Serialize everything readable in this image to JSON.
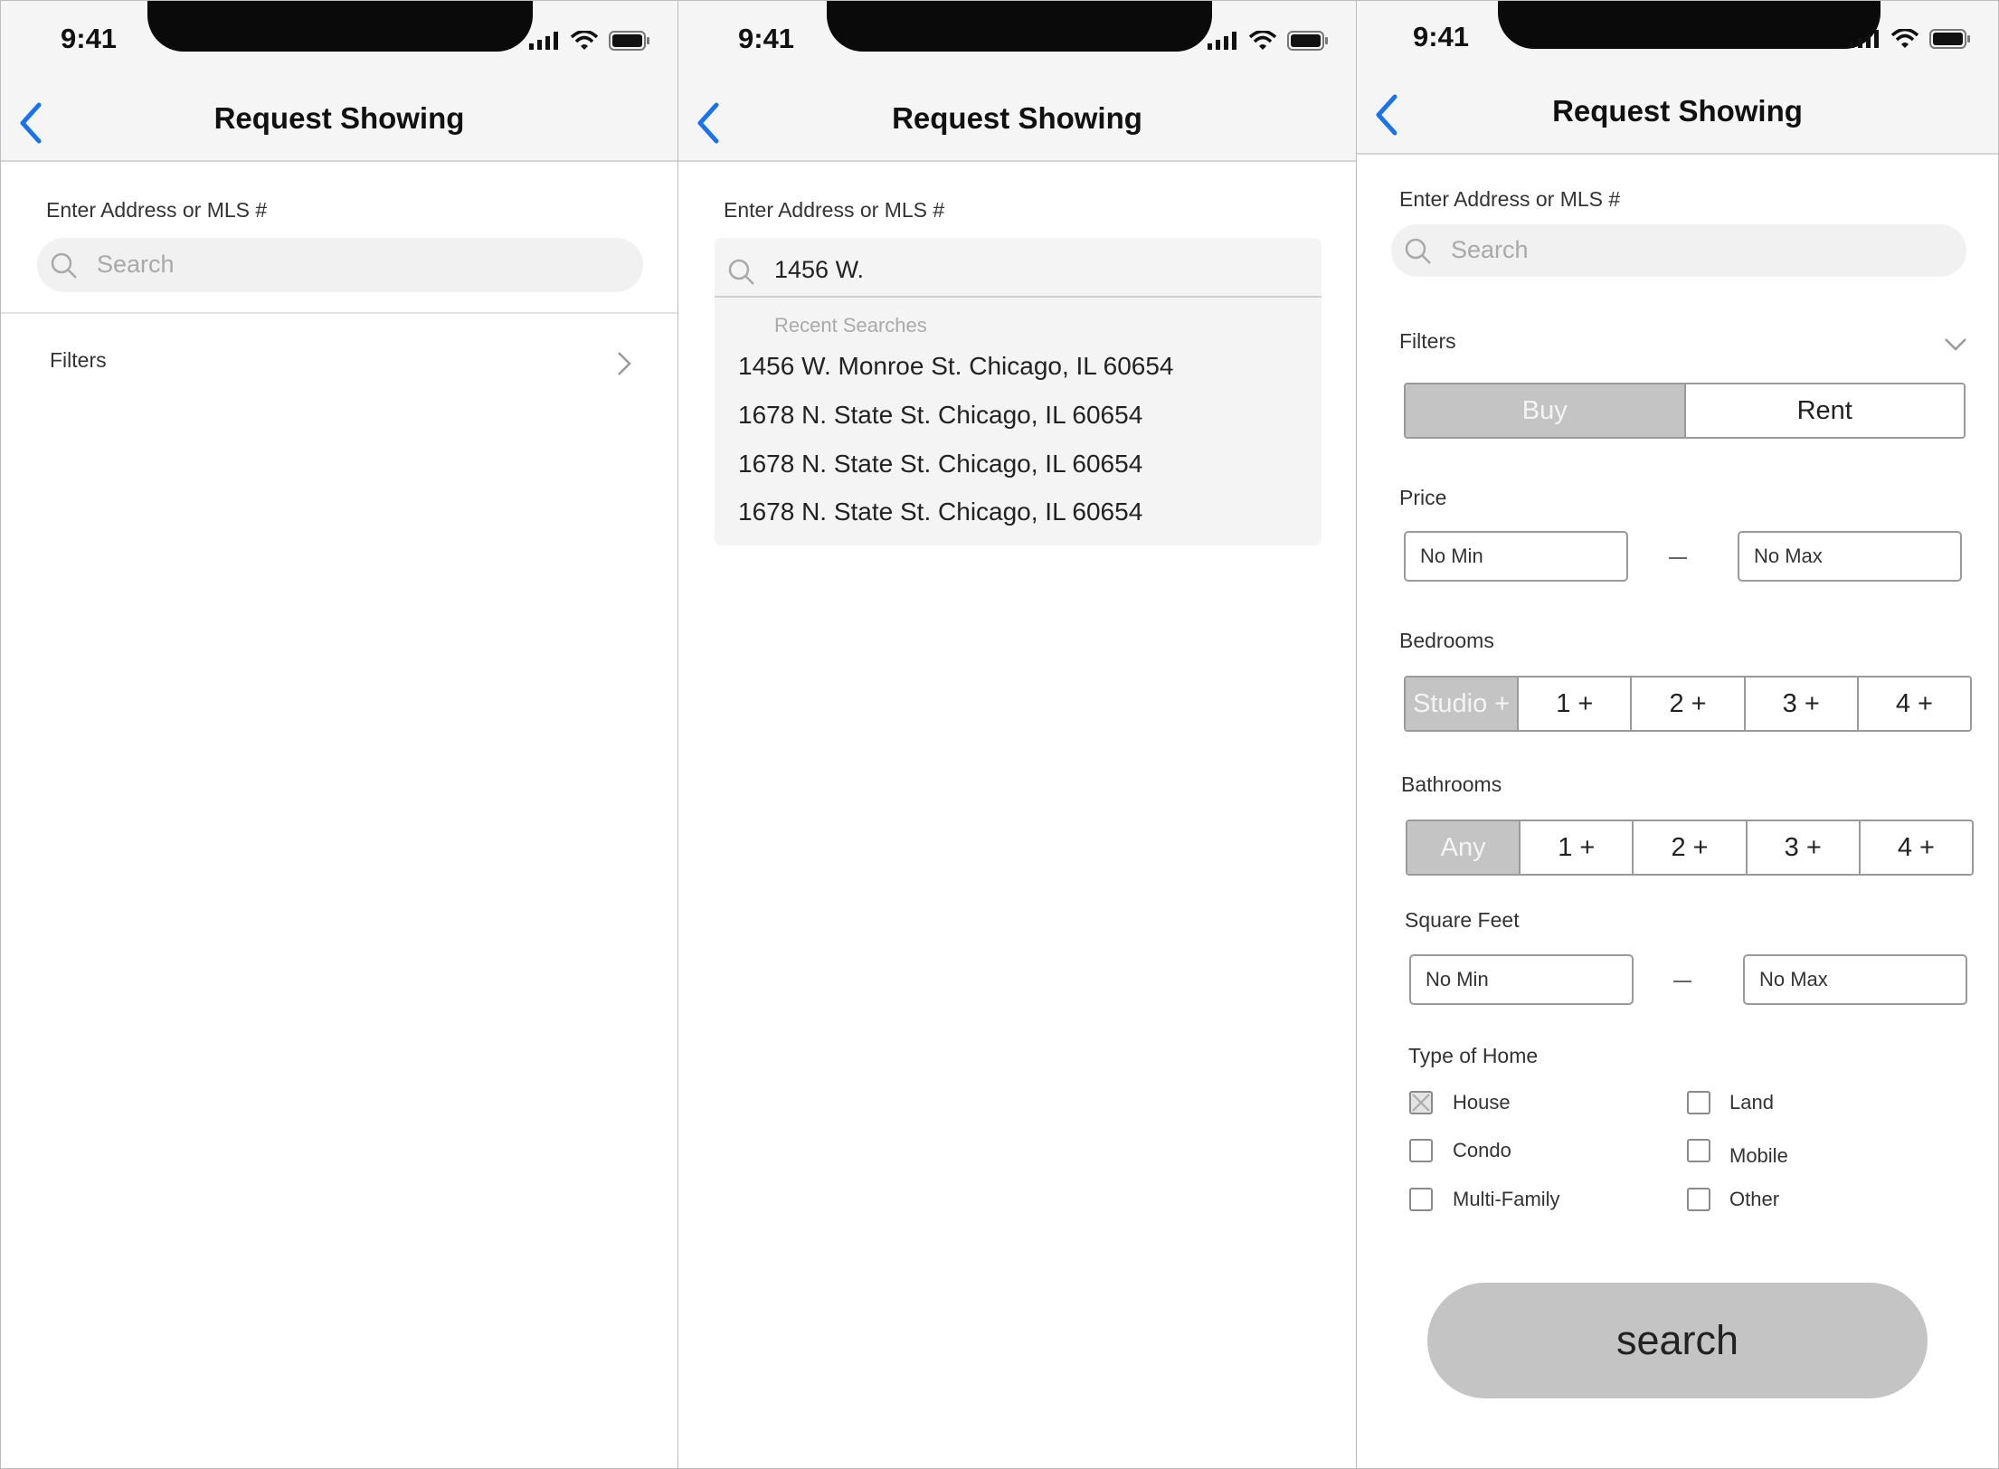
{
  "status": {
    "time": "9:41"
  },
  "header": {
    "title": "Request Showing"
  },
  "search": {
    "label": "Enter Address or MLS #",
    "placeholder": "Search"
  },
  "filters": {
    "label": "Filters"
  },
  "autocomplete": {
    "typed_value": "1456 W.",
    "recent_label": "Recent Searches",
    "items": [
      "1456 W. Monroe St. Chicago, IL 60654",
      "1678 N. State St. Chicago, IL 60654",
      "1678 N. State St. Chicago, IL 60654",
      "1678 N. State St. Chicago, IL 60654"
    ]
  },
  "listing_type": {
    "options": [
      "Buy",
      "Rent"
    ],
    "selected": "Buy"
  },
  "price": {
    "label": "Price",
    "min_placeholder": "No Min",
    "max_placeholder": "No Max"
  },
  "bedrooms": {
    "label": "Bedrooms",
    "options": [
      "Studio +",
      "1 +",
      "2 +",
      "3 +",
      "4 +"
    ],
    "selected": "Studio +"
  },
  "bathrooms": {
    "label": "Bathrooms",
    "options": [
      "Any",
      "1 +",
      "2 +",
      "3 +",
      "4 +"
    ],
    "selected": "Any"
  },
  "square_feet": {
    "label": "Square Feet",
    "min_placeholder": "No Min",
    "max_placeholder": "No Max"
  },
  "home_type": {
    "label": "Type of Home",
    "options": [
      {
        "label": "House",
        "checked": true
      },
      {
        "label": "Land",
        "checked": false
      },
      {
        "label": "Condo",
        "checked": false
      },
      {
        "label": "Mobile",
        "checked": false
      },
      {
        "label": "Multi-Family",
        "checked": false
      },
      {
        "label": "Other",
        "checked": false
      }
    ]
  },
  "search_button": {
    "label": "search"
  },
  "colors": {
    "accent": "#1a73e8",
    "selected_segment": "#c4c4c4",
    "header_bg": "#f5f5f5"
  }
}
